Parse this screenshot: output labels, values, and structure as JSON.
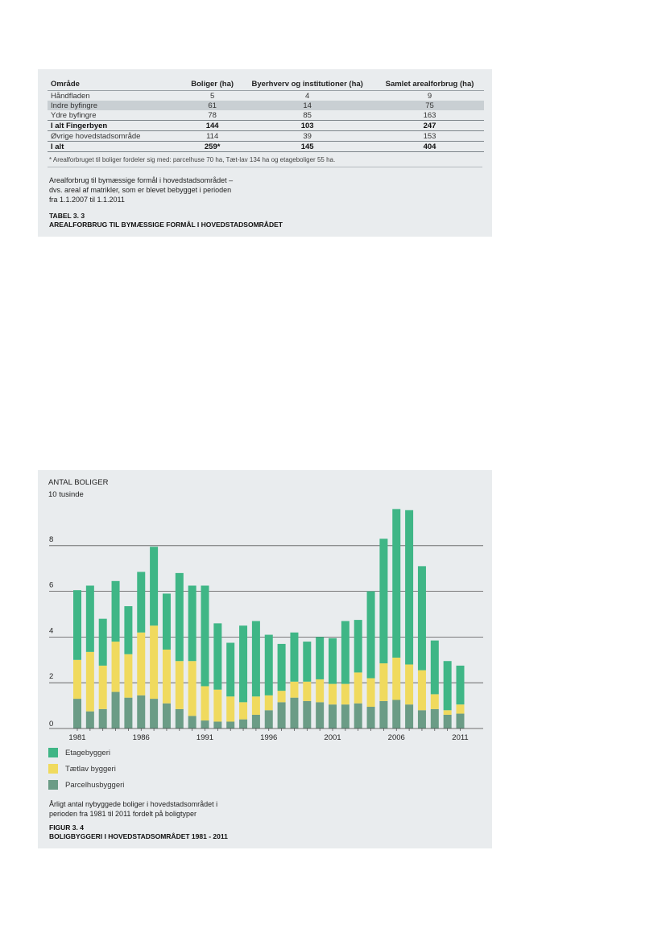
{
  "table": {
    "headers": [
      "Område",
      "Boliger (ha)",
      "Byerhverv og institutioner (ha)",
      "Samlet arealforbrug (ha)"
    ],
    "rows": [
      {
        "cells": [
          "Håndfladen",
          "5",
          "4",
          "9"
        ],
        "style": "plain"
      },
      {
        "cells": [
          "Indre byfingre",
          "61",
          "14",
          "75"
        ],
        "style": "shade"
      },
      {
        "cells": [
          "Ydre byfingre",
          "78",
          "85",
          "163"
        ],
        "style": "plain"
      },
      {
        "cells": [
          "I alt Fingerbyen",
          "144",
          "103",
          "247"
        ],
        "style": "bold"
      },
      {
        "cells": [
          "Øvrige hovedstadsområde",
          "114",
          "39",
          "153"
        ],
        "style": "plain"
      },
      {
        "cells": [
          "I alt",
          "259*",
          "145",
          "404"
        ],
        "style": "bold"
      }
    ],
    "footnote": "* Arealforbruget til boliger fordeler sig med: parcelhuse 70 ha, Tæt-lav 134 ha og etageboliger 55 ha.",
    "caption_line1": "Arealforbrug til bymæssige formål i hovedstadsområdet –",
    "caption_line2": "dvs. areal af matrikler, som er blevet bebygget i perioden",
    "caption_line3": "fra 1.1.2007 til 1.1.2011",
    "label_line1": "TABEL 3. 3",
    "label_line2": "AREALFORBRUG TIL BYMÆSSIGE FORMÅL I HOVEDSTADSOMRÅDET"
  },
  "figure": {
    "caption_line1": "Årligt antal nybyggede boliger i hovedstadsområdet i",
    "caption_line2": "perioden fra 1981 til 2011 fordelt på boligtyper",
    "label_line1": "FIGUR 3. 4",
    "label_line2": "BOLIGBYGGERI I HOVEDSTADSOMRÅDET 1981 - 2011"
  },
  "chart_data": {
    "type": "bar",
    "stacked": true,
    "title": "ANTAL BOLIGER",
    "subtitle": "10 tusinde",
    "xlabel": "",
    "ylabel": "",
    "categories": [
      1981,
      1982,
      1983,
      1984,
      1985,
      1986,
      1987,
      1988,
      1989,
      1990,
      1991,
      1992,
      1993,
      1994,
      1995,
      1996,
      1997,
      1998,
      1999,
      2000,
      2001,
      2002,
      2003,
      2004,
      2005,
      2006,
      2007,
      2008,
      2009,
      2010,
      2011
    ],
    "x_tick_labels": [
      "1981",
      "1986",
      "1991",
      "1996",
      "2001",
      "2006",
      "2011"
    ],
    "y_tick_labels": [
      "0",
      "2",
      "4",
      "6",
      "8"
    ],
    "ylim": [
      0,
      10
    ],
    "grid": "horizontal",
    "legend_position": "bottom-left",
    "series": [
      {
        "name": "Parcelhusbyggeri",
        "color": "#6b9c86",
        "values": [
          1.3,
          0.75,
          0.85,
          1.6,
          1.35,
          1.45,
          1.3,
          1.1,
          0.85,
          0.55,
          0.35,
          0.3,
          0.3,
          0.4,
          0.6,
          0.8,
          1.15,
          1.35,
          1.2,
          1.15,
          1.05,
          1.05,
          1.1,
          0.95,
          1.2,
          1.25,
          1.05,
          0.8,
          0.85,
          0.6,
          0.65
        ]
      },
      {
        "name": "Tætlav byggeri",
        "color": "#f0da5e",
        "values": [
          1.7,
          2.6,
          1.9,
          2.2,
          1.9,
          2.75,
          3.2,
          2.35,
          2.1,
          2.4,
          1.5,
          1.4,
          1.1,
          0.75,
          0.8,
          0.65,
          0.5,
          0.7,
          0.85,
          1.0,
          0.9,
          0.9,
          1.35,
          1.25,
          1.65,
          1.85,
          1.75,
          1.75,
          0.65,
          0.2,
          0.4
        ]
      },
      {
        "name": "Etagebyggeri",
        "color": "#3fb686",
        "values": [
          3.05,
          2.9,
          2.05,
          2.65,
          2.1,
          2.65,
          3.45,
          2.45,
          3.85,
          3.3,
          4.4,
          2.9,
          2.35,
          3.35,
          3.3,
          2.65,
          2.05,
          2.15,
          1.75,
          1.85,
          2.0,
          2.75,
          2.3,
          3.8,
          5.45,
          6.5,
          6.75,
          4.55,
          2.35,
          2.15,
          1.7
        ]
      }
    ]
  }
}
